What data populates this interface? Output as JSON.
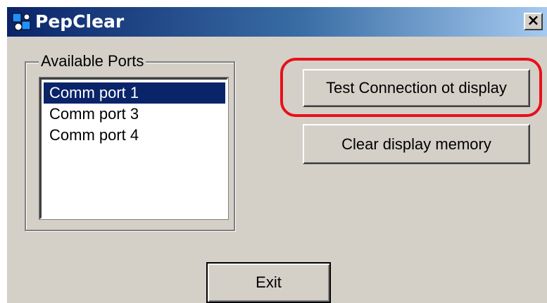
{
  "window": {
    "title": "PepClear",
    "icon": "app-icon",
    "close_label": "×"
  },
  "ports": {
    "legend": "Available Ports",
    "items": [
      "Comm port 1",
      "Comm port 3",
      "Comm port 4"
    ],
    "selected": "Comm port 1"
  },
  "buttons": {
    "test": "Test Connection ot display",
    "clear": "Clear display memory",
    "exit": "Exit"
  },
  "annotation": {
    "color": "#e8101a",
    "target": "test-connection-button"
  },
  "colors": {
    "face": "#d4d0c8",
    "title_start": "#0a246a",
    "selection": "#0a246a"
  }
}
